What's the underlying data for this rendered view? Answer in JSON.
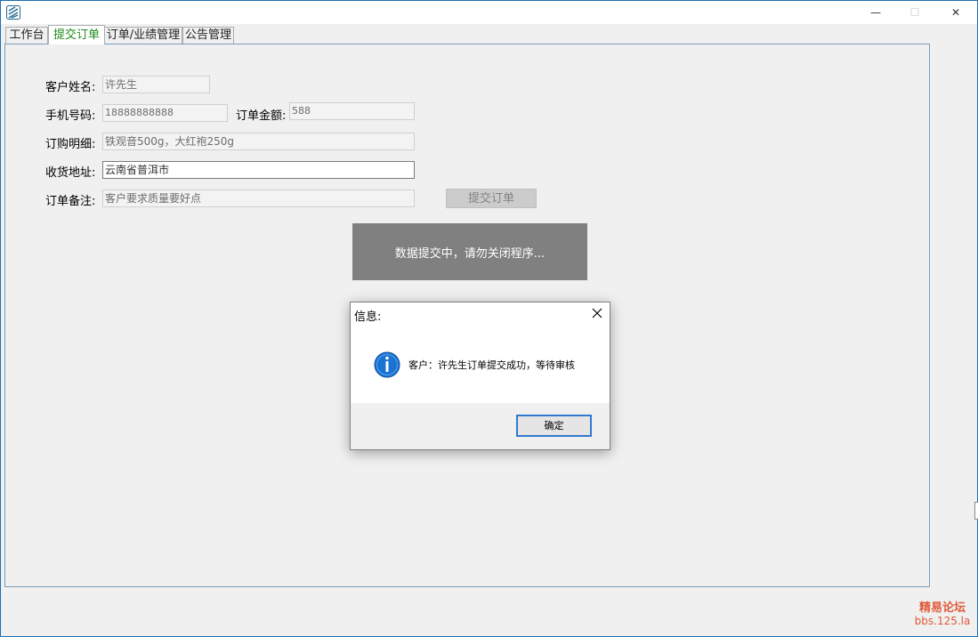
{
  "window": {
    "minimize_glyph": "—",
    "maximize_glyph": "☐",
    "close_glyph": "✕"
  },
  "tabs": [
    {
      "label": "工作台"
    },
    {
      "label": "提交订单"
    },
    {
      "label": "订单/业绩管理"
    },
    {
      "label": "公告管理"
    }
  ],
  "form": {
    "name_label": "客户姓名:",
    "name_value": "许先生",
    "phone_label": "手机号码:",
    "phone_value": "18888888888",
    "amount_label": "订单金额:",
    "amount_value": "588",
    "detail_label": "订购明细:",
    "detail_value": "铁观音500g，大红袍250g",
    "address_label": "收货地址:",
    "address_value": "云南省普洱市",
    "note_label": "订单备注:",
    "note_value": "客户要求质量要好点",
    "submit_label": "提交订单"
  },
  "progress_message": "数据提交中，请勿关闭程序...",
  "dialog": {
    "title": "信息:",
    "message": "客户：许先生订单提交成功，等待审核",
    "ok_label": "确定"
  },
  "watermark": {
    "line1": "精易论坛",
    "line2": "bbs.125.la"
  },
  "colors": {
    "active_tab_text": "#1e8a1e",
    "progress_bg": "#808080",
    "dialog_button_border": "#2f7ad0",
    "info_icon": "#1a73d1",
    "watermark": "#e05a3a"
  }
}
